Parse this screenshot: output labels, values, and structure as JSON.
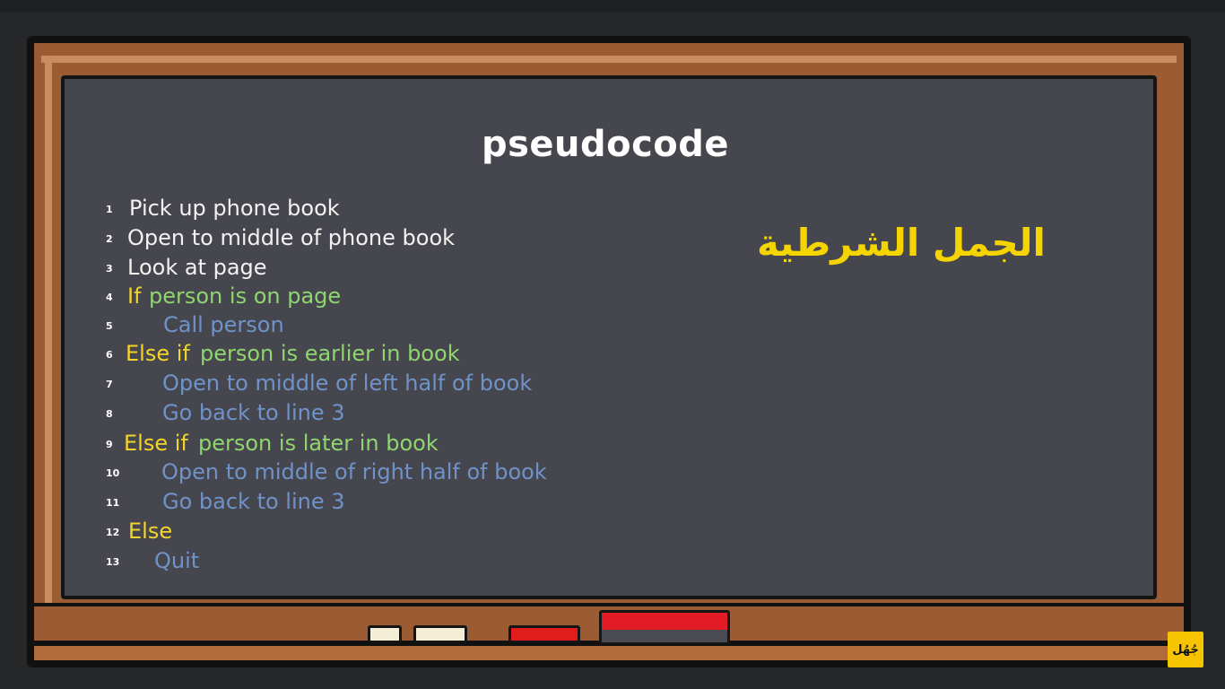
{
  "title": "pseudocode",
  "arabic_title": "الجمل الشرطية",
  "logo_text": "جُهُل",
  "colors": {
    "board": "#46464e",
    "wood": "#9c5c33",
    "white": "#f2f2f2",
    "keyword_yellow": "#f3d52a",
    "condition_green": "#8fd66e",
    "action_blue": "#6f93c9",
    "arabic_title_yellow": "#f5d400"
  },
  "lines": [
    {
      "num": "1",
      "kw": "",
      "text": "Pick up phone book"
    },
    {
      "num": "2",
      "kw": "",
      "text": "Open to middle of phone book"
    },
    {
      "num": "3",
      "kw": "",
      "text": "Look at page"
    },
    {
      "num": "4",
      "kw": "If",
      "text": "person is on page"
    },
    {
      "num": "5",
      "kw": "",
      "text": "Call person"
    },
    {
      "num": "6",
      "kw": "Else if",
      "text": "person is earlier in book"
    },
    {
      "num": "7",
      "kw": "",
      "text": "Open to middle of left half of book"
    },
    {
      "num": "8",
      "kw": "",
      "text": "Go back to line 3"
    },
    {
      "num": "9",
      "kw": "Else if",
      "text": "person is later in book"
    },
    {
      "num": "10",
      "kw": "",
      "text": "Open to middle of right half of book"
    },
    {
      "num": "11",
      "kw": "",
      "text": "Go back to line 3"
    },
    {
      "num": "12",
      "kw": "Else",
      "text": ""
    },
    {
      "num": "13",
      "kw": "",
      "text": "Quit"
    }
  ]
}
